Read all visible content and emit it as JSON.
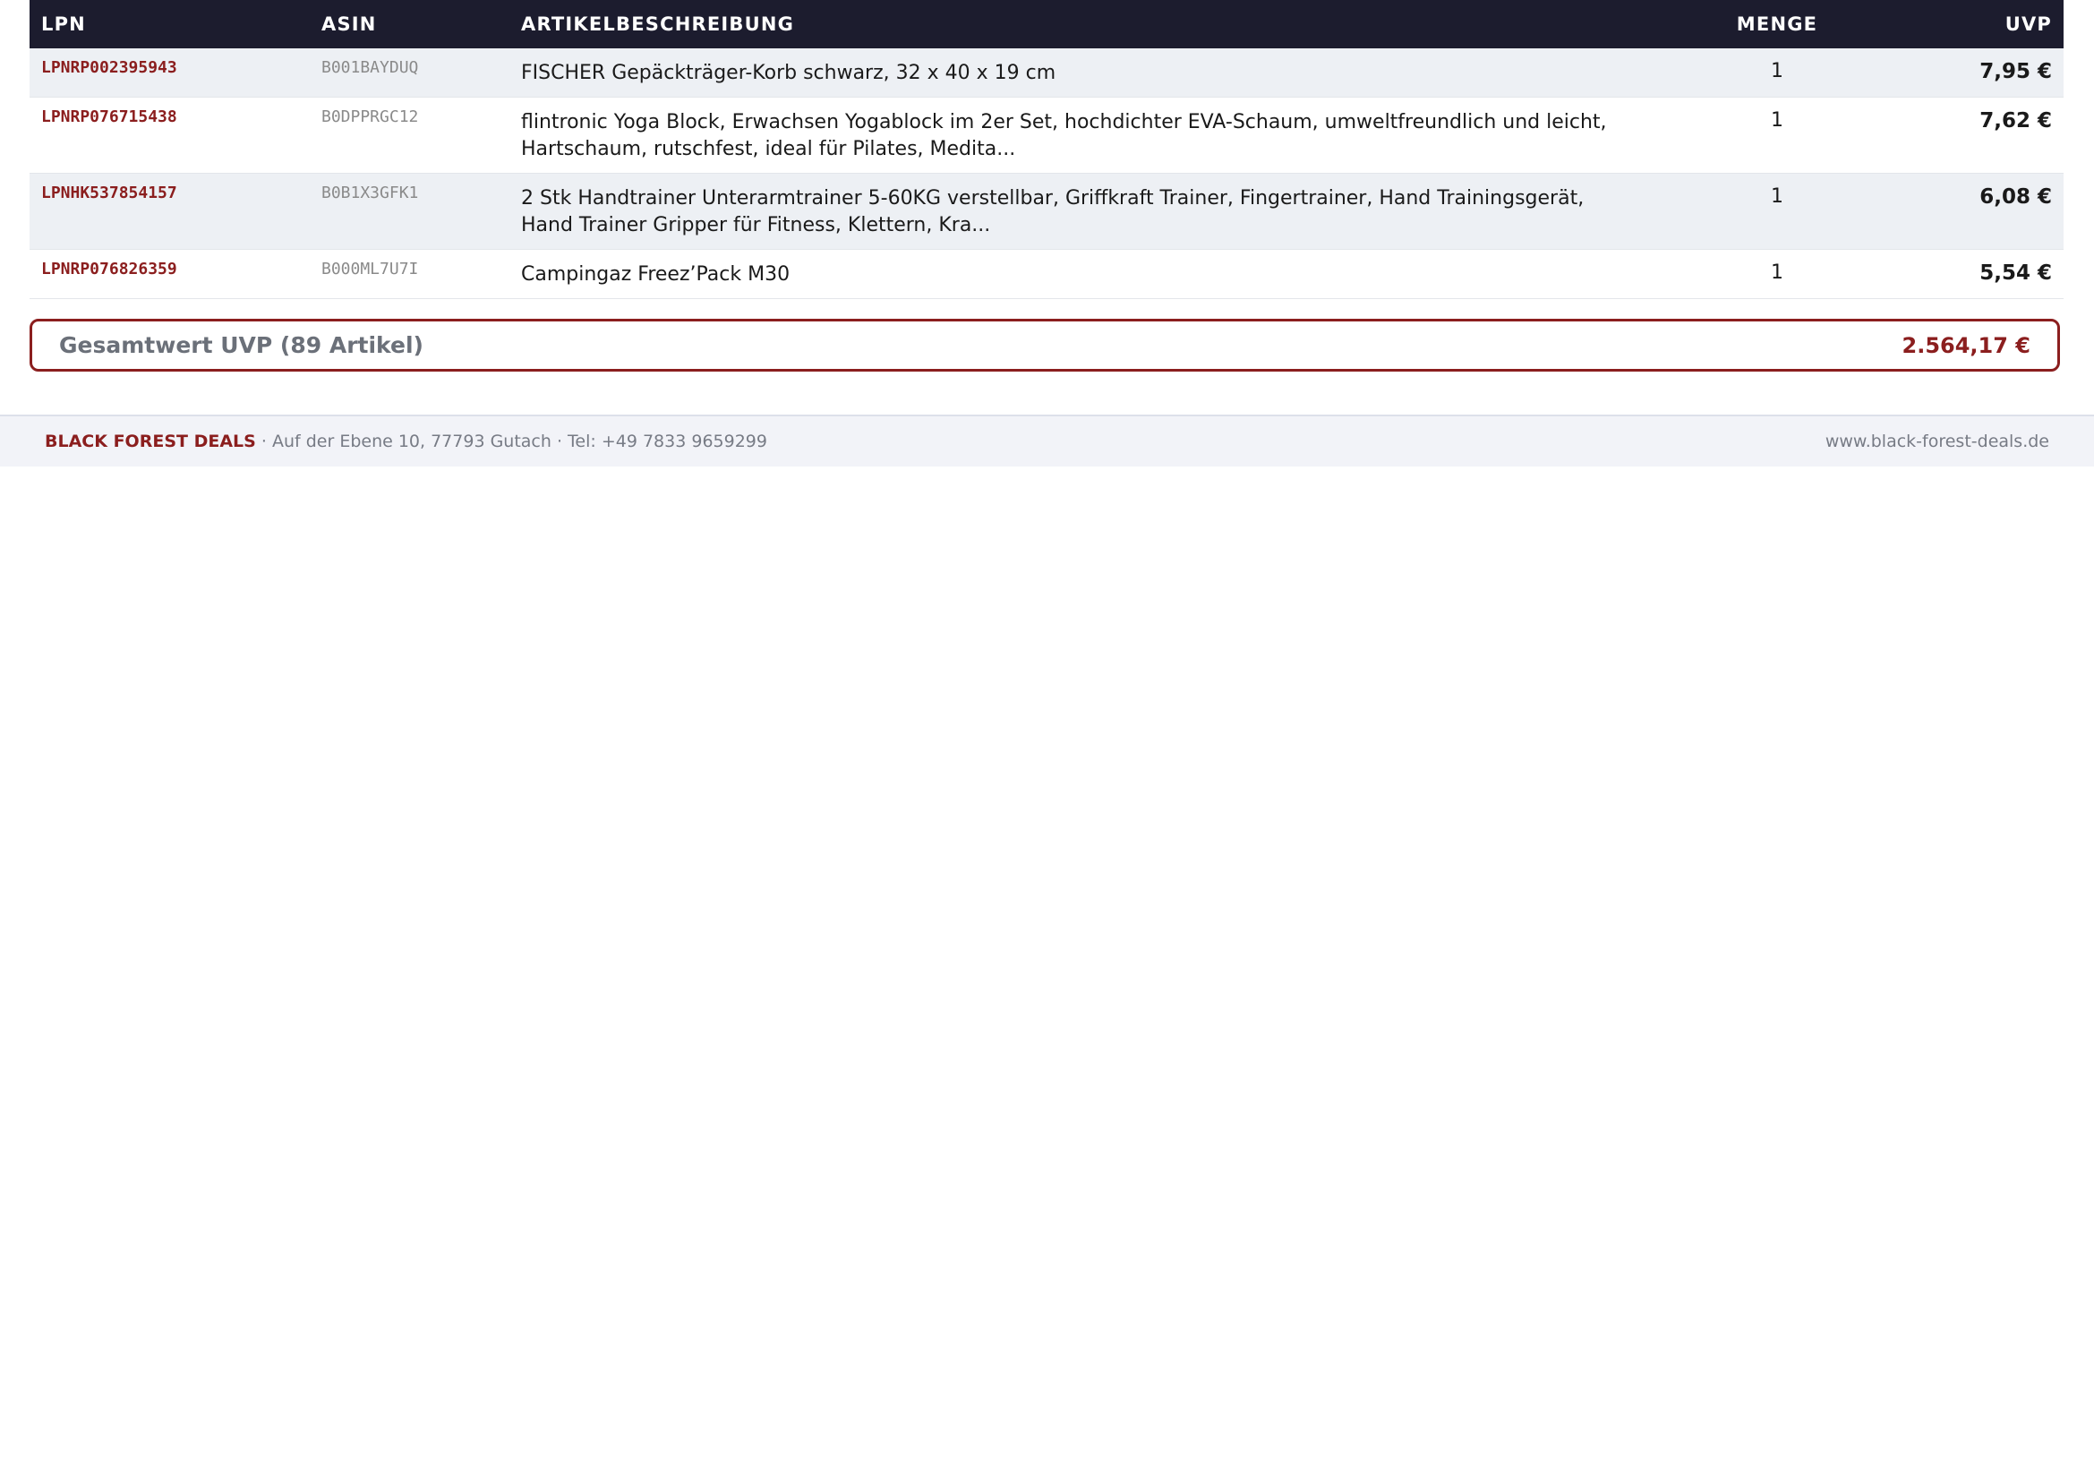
{
  "table": {
    "headers": {
      "lpn": "LPN",
      "asin": "ASIN",
      "description": "ARTIKELBESCHREIBUNG",
      "quantity": "MENGE",
      "uvp": "UVP"
    },
    "rows": [
      {
        "lpn": "LPNRP002395943",
        "asin": "B001BAYDUQ",
        "description": "FISCHER Gepäckträger-Korb schwarz, 32 x 40 x 19 cm",
        "quantity": "1",
        "uvp": "7,95 €"
      },
      {
        "lpn": "LPNRP076715438",
        "asin": "B0DPPRGC12",
        "description": "flintronic Yoga Block, Erwachsen Yogablock im 2er Set, hochdichter EVA-Schaum, umweltfreundlich und leicht, Hartschaum, rutschfest, ideal für Pilates, Medita...",
        "quantity": "1",
        "uvp": "7,62 €"
      },
      {
        "lpn": "LPNHK537854157",
        "asin": "B0B1X3GFK1",
        "description": "2 Stk Handtrainer Unterarmtrainer 5-60KG verstellbar, Griffkraft Trainer, Fingertrainer, Hand Trainingsgerät, Hand Trainer Gripper für Fitness, Klettern, Kra...",
        "quantity": "1",
        "uvp": "6,08 €"
      },
      {
        "lpn": "LPNRP076826359",
        "asin": "B000ML7U7I",
        "description": "Campingaz Freez’Pack M30",
        "quantity": "1",
        "uvp": "5,54 €"
      }
    ]
  },
  "total": {
    "label": "Gesamtwert UVP (89 Artikel)",
    "value": "2.564,17 €"
  },
  "footer": {
    "brand": "BLACK FOREST DEALS",
    "address": " · Auf der Ebene 10, 77793 Gutach · Tel: +49 7833 9659299",
    "website": "www.black-forest-deals.de"
  },
  "colors": {
    "header_bg": "#1c1c2e",
    "accent": "#8b1e1e",
    "row_alt": "#edf0f4",
    "footer_bg": "#f2f3f8"
  }
}
